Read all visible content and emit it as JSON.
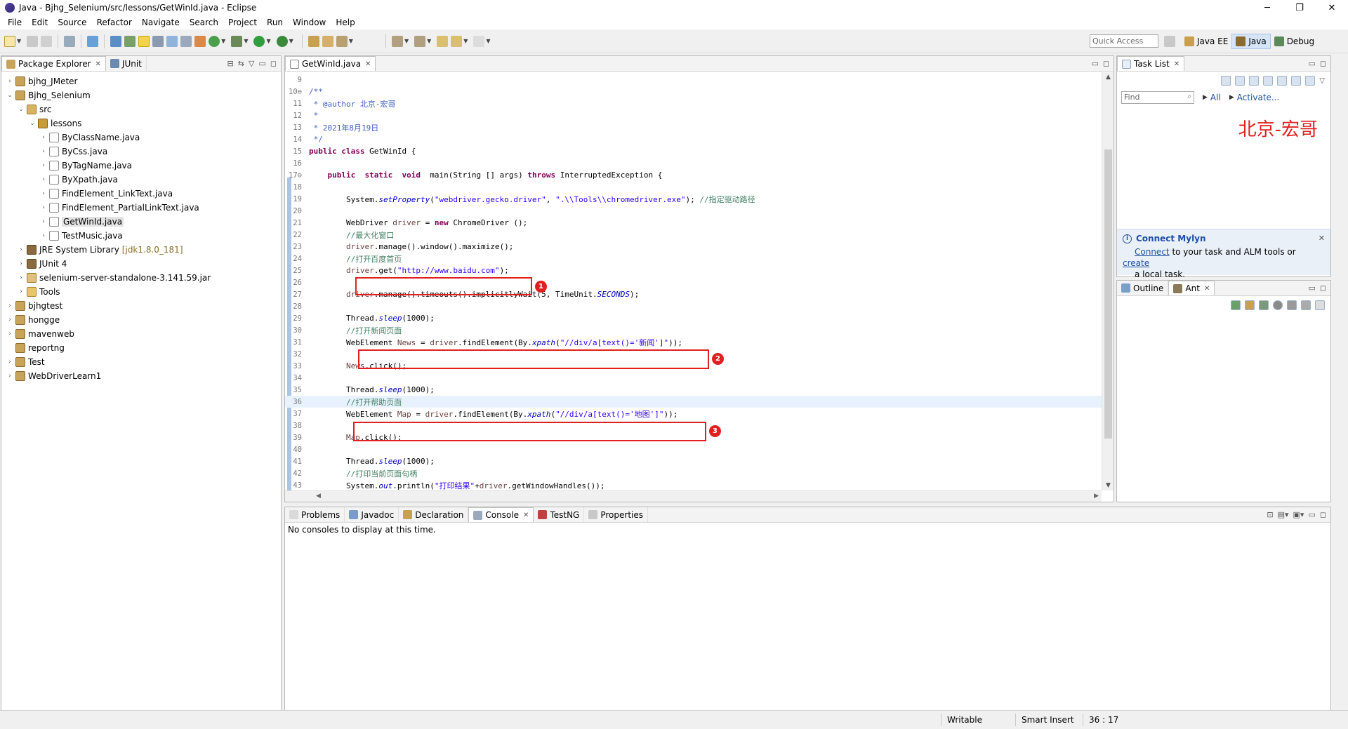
{
  "window": {
    "title": "Java - Bjhg_Selenium/src/lessons/GetWinId.java - Eclipse",
    "minimize": "─",
    "maximize": "❐",
    "close": "✕"
  },
  "menu": [
    "File",
    "Edit",
    "Source",
    "Refactor",
    "Navigate",
    "Search",
    "Project",
    "Run",
    "Window",
    "Help"
  ],
  "quick_access": {
    "placeholder": "Quick Access"
  },
  "perspectives": [
    {
      "label": "Java EE",
      "active": false
    },
    {
      "label": "Java",
      "active": true
    },
    {
      "label": "Debug",
      "active": false
    }
  ],
  "package_explorer": {
    "tabs": [
      {
        "label": "Package Explorer",
        "active": true
      },
      {
        "label": "JUnit",
        "active": false
      }
    ],
    "tree": [
      {
        "label": "bjhg_JMeter",
        "depth": 0,
        "expanded": false,
        "icon": "project-icon"
      },
      {
        "label": "Bjhg_Selenium",
        "depth": 0,
        "expanded": true,
        "icon": "project-icon"
      },
      {
        "label": "src",
        "depth": 1,
        "expanded": true,
        "icon": "source-folder-icon"
      },
      {
        "label": "lessons",
        "depth": 2,
        "expanded": true,
        "icon": "package-icon"
      },
      {
        "label": "ByClassName.java",
        "depth": 3,
        "expanded": false,
        "icon": "java-file-icon"
      },
      {
        "label": "ByCss.java",
        "depth": 3,
        "expanded": false,
        "icon": "java-file-icon"
      },
      {
        "label": "ByTagName.java",
        "depth": 3,
        "expanded": false,
        "icon": "java-file-icon"
      },
      {
        "label": "ByXpath.java",
        "depth": 3,
        "expanded": false,
        "icon": "java-file-icon"
      },
      {
        "label": "FindElement_LinkText.java",
        "depth": 3,
        "expanded": false,
        "icon": "java-file-icon"
      },
      {
        "label": "FindElement_PartialLinkText.java",
        "depth": 3,
        "expanded": false,
        "icon": "java-file-icon"
      },
      {
        "label": "GetWinId.java",
        "depth": 3,
        "expanded": false,
        "icon": "java-file-icon",
        "selected": true
      },
      {
        "label": "TestMusic.java",
        "depth": 3,
        "expanded": false,
        "icon": "java-file-icon"
      },
      {
        "label": "JRE System Library",
        "lib": "[jdk1.8.0_181]",
        "depth": 1,
        "expanded": false,
        "icon": "library-icon"
      },
      {
        "label": "JUnit 4",
        "depth": 1,
        "expanded": false,
        "icon": "library-icon"
      },
      {
        "label": "selenium-server-standalone-3.141.59.jar",
        "depth": 1,
        "expanded": false,
        "icon": "jar-icon"
      },
      {
        "label": "Tools",
        "depth": 1,
        "expanded": false,
        "icon": "folder-icon"
      },
      {
        "label": "bjhgtest",
        "depth": 0,
        "expanded": false,
        "icon": "project-icon"
      },
      {
        "label": "hongge",
        "depth": 0,
        "expanded": false,
        "icon": "project-icon"
      },
      {
        "label": "mavenweb",
        "depth": 0,
        "expanded": false,
        "icon": "project-icon"
      },
      {
        "label": "reportng",
        "depth": 0,
        "expanded": null,
        "icon": "project-icon"
      },
      {
        "label": "Test",
        "depth": 0,
        "expanded": false,
        "icon": "project-icon"
      },
      {
        "label": "WebDriverLearn1",
        "depth": 0,
        "expanded": false,
        "icon": "project-icon"
      }
    ]
  },
  "editor": {
    "tab": "GetWinId.java",
    "lines": [
      {
        "n": "9",
        "html": ""
      },
      {
        "n": "10⊖",
        "html": "<span class='jd'>/**</span>"
      },
      {
        "n": "11",
        "html": "<span class='jd'> * @author 北京-宏哥</span>"
      },
      {
        "n": "12",
        "html": "<span class='jd'> *</span>"
      },
      {
        "n": "13",
        "html": "<span class='jd'> * 2021年8月19日</span>"
      },
      {
        "n": "14",
        "html": "<span class='jd'> */</span>"
      },
      {
        "n": "15",
        "html": "<span class='kw'>public class</span> GetWinId {"
      },
      {
        "n": "16",
        "html": ""
      },
      {
        "n": "17⊖",
        "html": "    <span class='kw'>public</span>  <span class='kw'>static</span>  <span class='kw'>void</span>  main(String [] args) <span class='kw'>throws</span> InterruptedException {"
      },
      {
        "n": "18",
        "html": ""
      },
      {
        "n": "19",
        "html": "        System.<span class='st'>setProperty</span>(<span class='str'>\"webdriver.gecko.driver\"</span>, <span class='str'>\".\\\\Tools\\\\chromedriver.exe\"</span>); <span class='cm'>//指定驱动路径</span>"
      },
      {
        "n": "20",
        "html": ""
      },
      {
        "n": "21",
        "html": "        WebDriver <span class='var'>driver</span> = <span class='kw'>new</span> ChromeDriver ();"
      },
      {
        "n": "22",
        "html": "        <span class='cm'>//最大化窗口</span>"
      },
      {
        "n": "23",
        "html": "        <span class='var'>driver</span>.manage().window().maximize();"
      },
      {
        "n": "24",
        "html": "        <span class='cm'>//打开百度首页</span>"
      },
      {
        "n": "25",
        "html": "        <span class='var'>driver</span>.get(<span class='str'>\"http://www.baidu.com\"</span>);"
      },
      {
        "n": "26",
        "html": ""
      },
      {
        "n": "27",
        "html": "        <span class='var'>driver</span>.manage().timeouts().implicitlyWait(5, TimeUnit.<span class='st'>SECONDS</span>);"
      },
      {
        "n": "28",
        "html": ""
      },
      {
        "n": "29",
        "html": "        Thread.<span class='st'>sleep</span>(1000);"
      },
      {
        "n": "30",
        "html": "        <span class='cm'>//打开新闻页面</span>"
      },
      {
        "n": "31",
        "html": "        WebElement <span class='var'>News</span> = <span class='var'>driver</span>.findElement(By.<span class='st'>xpath</span>(<span class='str'>\"//div/a[text()='新闻']\"</span>));"
      },
      {
        "n": "32",
        "html": ""
      },
      {
        "n": "33",
        "html": "        <span class='var'>News</span>.click();"
      },
      {
        "n": "34",
        "html": ""
      },
      {
        "n": "35",
        "html": "        Thread.<span class='st'>sleep</span>(1000);"
      },
      {
        "n": "36",
        "html": "        <span class='cm'>//打开帮助页面</span>",
        "current": true
      },
      {
        "n": "37",
        "html": "        WebElement <span class='var'>Map</span> = <span class='var'>driver</span>.findElement(By.<span class='st'>xpath</span>(<span class='str'>\"//div/a[text()='地图']\"</span>));"
      },
      {
        "n": "38",
        "html": ""
      },
      {
        "n": "39",
        "html": "        <span class='var'>Map</span>.click();"
      },
      {
        "n": "40",
        "html": ""
      },
      {
        "n": "41",
        "html": "        Thread.<span class='st'>sleep</span>(1000);"
      },
      {
        "n": "42",
        "html": "        <span class='cm'>//打印当前页面句柄</span>"
      },
      {
        "n": "43",
        "html": "        System.<span class='fld'><i>out</i></span>.println(<span class='str'>\"打印结果\"</span>+<span class='var'>driver</span>.getWindowHandles());"
      }
    ],
    "annotations": [
      "1",
      "2",
      "3"
    ]
  },
  "task_list": {
    "tab": "Task List",
    "find_placeholder": "Find",
    "all_label": "All",
    "activate_label": "Activate...",
    "watermark": "北京-宏哥",
    "mylyn": {
      "title": "Connect Mylyn",
      "connect": "Connect",
      "text_mid": " to your task and ALM tools or ",
      "create": "create",
      "text_end": "a local task."
    }
  },
  "outline": {
    "tabs": [
      {
        "label": "Outline",
        "active": false
      },
      {
        "label": "Ant",
        "active": true
      }
    ]
  },
  "bottom": {
    "tabs": [
      {
        "label": "Problems",
        "active": false
      },
      {
        "label": "Javadoc",
        "active": false
      },
      {
        "label": "Declaration",
        "active": false
      },
      {
        "label": "Console",
        "active": true
      },
      {
        "label": "TestNG",
        "active": false
      },
      {
        "label": "Properties",
        "active": false
      }
    ],
    "console_message": "No consoles to display at this time."
  },
  "status": {
    "writable": "Writable",
    "insert_mode": "Smart Insert",
    "position": "36 : 17"
  },
  "colors": {
    "annotation_red": "#e02020",
    "link_blue": "#1f4ea5",
    "active_perspective": "#d5e4f7"
  }
}
